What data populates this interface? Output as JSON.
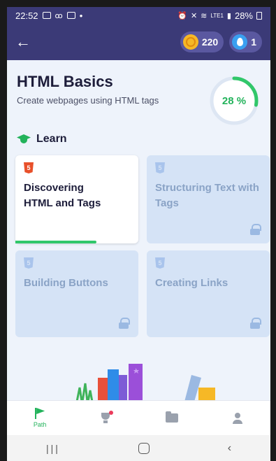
{
  "status": {
    "time": "22:52",
    "battery": "28%",
    "network": "LTE1"
  },
  "header": {
    "coins": "220",
    "streak": "1"
  },
  "course": {
    "title": "HTML Basics",
    "subtitle": "Create webpages using HTML tags",
    "progress_label": "28 %",
    "progress": 0.28
  },
  "learn": {
    "label": "Learn"
  },
  "lessons": [
    {
      "title": "Discovering HTML and Tags",
      "locked": false,
      "progress": 0.66
    },
    {
      "title": "Structuring Text with Tags",
      "locked": true
    },
    {
      "title": "Building Buttons",
      "locked": true
    },
    {
      "title": "Creating Links",
      "locked": true
    }
  ],
  "nav": {
    "path_label": "Path"
  },
  "colors": {
    "header_bg": "#3b3a77",
    "accent_green": "#23b35b",
    "html_orange": "#e8502a",
    "locked_card": "#d5e3f6"
  }
}
